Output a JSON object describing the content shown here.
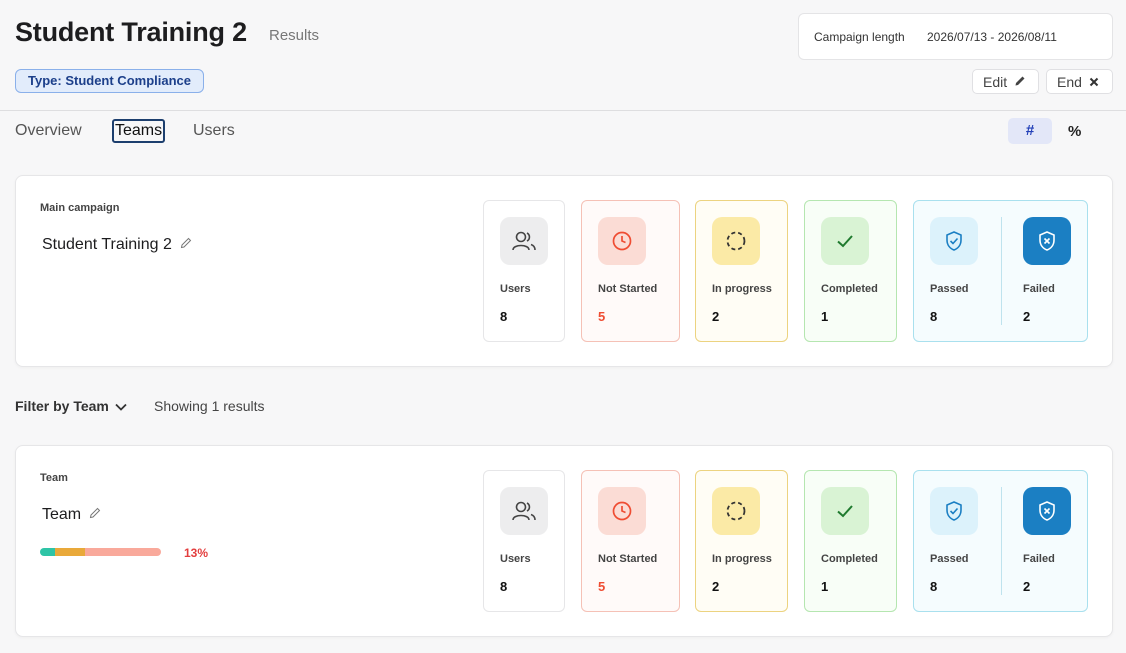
{
  "header": {
    "title": "Student Training 2",
    "subtitle": "Results",
    "type_badge": "Type: Student Compliance",
    "campaign_length_label": "Campaign length",
    "campaign_length_value": "2026/07/13 - 2026/08/11",
    "edit_label": "Edit",
    "end_label": "End"
  },
  "tabs": [
    {
      "label": "Overview",
      "active": false
    },
    {
      "label": "Teams",
      "active": true
    },
    {
      "label": "Users",
      "active": false
    }
  ],
  "view_toggle": {
    "count_label": "#",
    "percent_label": "%",
    "selected": "#"
  },
  "main_campaign": {
    "label": "Main campaign",
    "name": "Student Training 2",
    "stats": {
      "users": {
        "label": "Users",
        "value": "8"
      },
      "not_started": {
        "label": "Not Started",
        "value": "5"
      },
      "in_progress": {
        "label": "In progress",
        "value": "2"
      },
      "completed": {
        "label": "Completed",
        "value": "1"
      },
      "passed": {
        "label": "Passed",
        "value": "8"
      },
      "failed": {
        "label": "Failed",
        "value": "2"
      }
    }
  },
  "filter": {
    "label": "Filter by Team",
    "showing": "Showing 1 results"
  },
  "team_card": {
    "label": "Team",
    "name": "Team",
    "progress_pct": "13%",
    "progress": {
      "completed": 0.125,
      "in_progress": 0.25,
      "not_started": 0.625
    },
    "stats": {
      "users": {
        "label": "Users",
        "value": "8"
      },
      "not_started": {
        "label": "Not Started",
        "value": "5"
      },
      "in_progress": {
        "label": "In progress",
        "value": "2"
      },
      "completed": {
        "label": "Completed",
        "value": "1"
      },
      "passed": {
        "label": "Passed",
        "value": "8"
      },
      "failed": {
        "label": "Failed",
        "value": "2"
      }
    }
  },
  "colors": {
    "accent": "#2340b8",
    "not_started": "#ef4d33",
    "in_progress": "#e9a93a",
    "completed": "#2ec4a6",
    "failed": "#1b7fc3",
    "percent_red": "#e33e3e"
  }
}
